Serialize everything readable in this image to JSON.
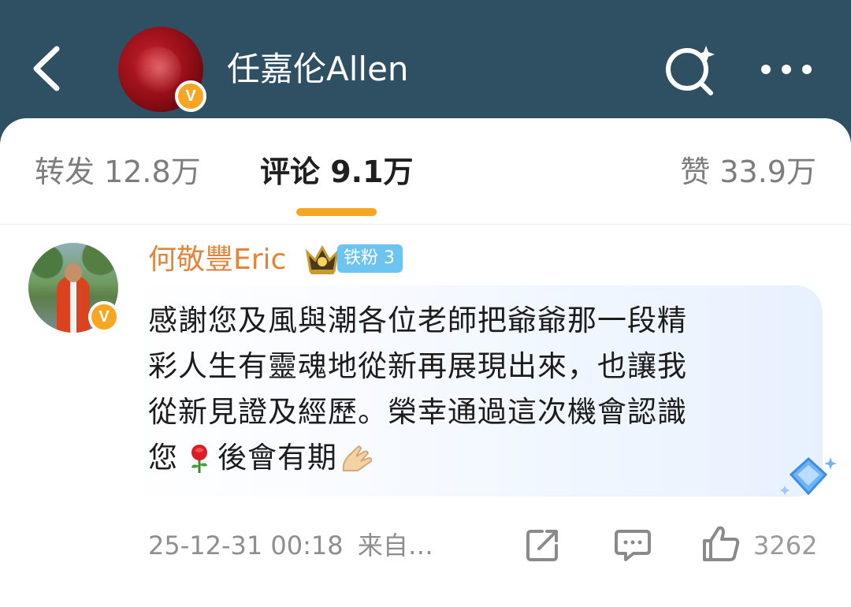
{
  "header": {
    "title": "任嘉伦Allen",
    "verified_mark": "V"
  },
  "tabs": [
    {
      "label": "转发 12.8万"
    },
    {
      "label": "评论 9.1万"
    },
    {
      "label": "赞 33.9万"
    }
  ],
  "comment": {
    "author": "何敬豐Eric",
    "verified_mark": "V",
    "fan_badge": "铁粉 3",
    "text_lines": [
      "感謝您及風與潮各位老師把爺爺那一段精",
      "彩人生有靈魂地從新再展現出來，也讓我",
      "從新見證及經歷。榮幸通過這次機會認識"
    ],
    "last_line_start": "您",
    "last_line_end": "後會有期",
    "timestamp": "25-12-31 00:18",
    "source": "来自…",
    "like_count": "3262"
  },
  "colors": {
    "header_bg": "#2f4f63",
    "accent": "#f5a623",
    "username": "#e2853b",
    "fan_badge": "#6ec4f0"
  },
  "icons": [
    "back-icon",
    "search-icon",
    "more-icon",
    "crown-icon",
    "rose-emoji",
    "pray-hands-emoji",
    "diamond-icon",
    "share-icon",
    "comment-icon",
    "like-icon"
  ]
}
